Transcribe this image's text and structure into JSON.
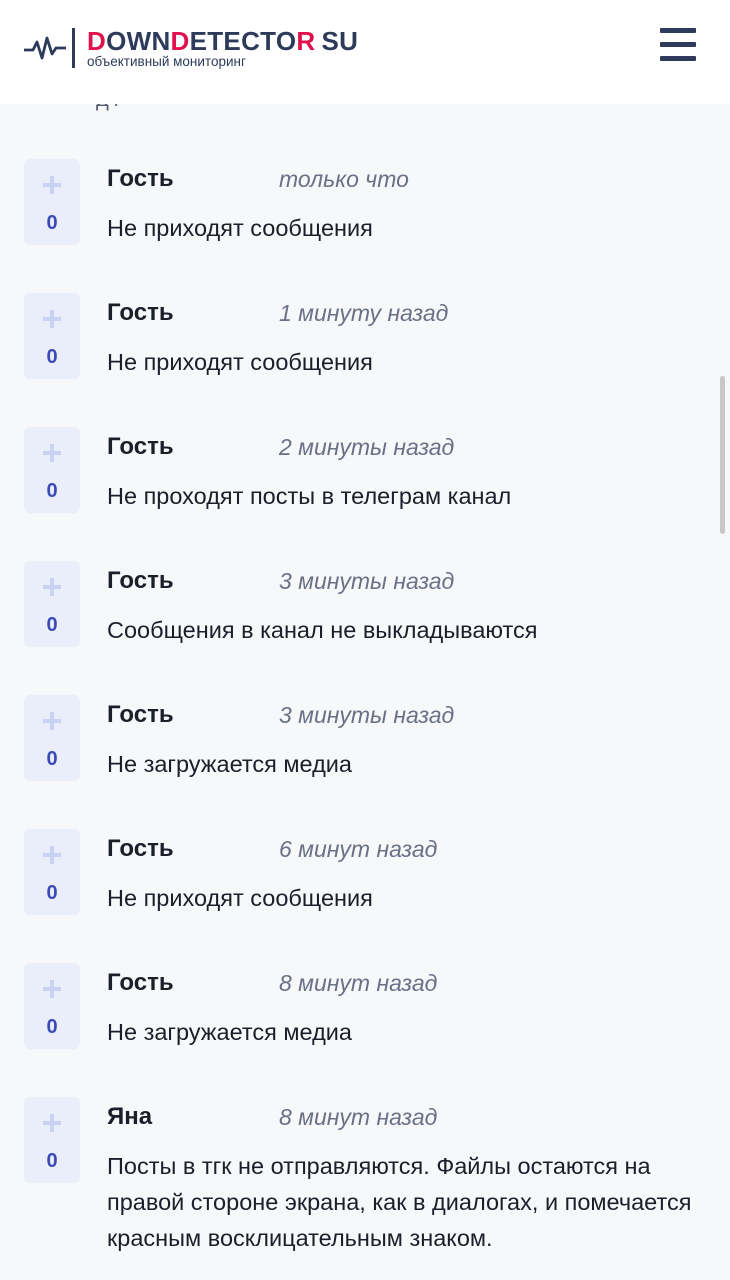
{
  "header": {
    "brand_parts": [
      "D",
      "OWN",
      "D",
      "ETECTO",
      "R"
    ],
    "brand_su": "SU",
    "subtitle": "объективный мониторинг"
  },
  "cutoff_text": "д       /",
  "comments": [
    {
      "author": "Гость",
      "time": "только что",
      "text": "Не приходят сообщения",
      "votes": "0"
    },
    {
      "author": "Гость",
      "time": "1 минуту назад",
      "text": "Не приходят сообщения",
      "votes": "0"
    },
    {
      "author": "Гость",
      "time": "2 минуты назад",
      "text": "Не проходят посты в телеграм канал",
      "votes": "0"
    },
    {
      "author": "Гость",
      "time": "3 минуты назад",
      "text": "Сообщения в канал не выкладываются",
      "votes": "0"
    },
    {
      "author": "Гость",
      "time": "3 минуты назад",
      "text": "Не загружается медиа",
      "votes": "0"
    },
    {
      "author": "Гость",
      "time": "6 минут назад",
      "text": "Не приходят сообщения",
      "votes": "0"
    },
    {
      "author": "Гость",
      "time": "8 минут назад",
      "text": "Не загружается медиа",
      "votes": "0"
    },
    {
      "author": "Яна",
      "time": "8 минут назад",
      "text": "Посты в тгк не отправляются. Файлы остаются на правой стороне экрана, как в диалогах, и помечается красным восклицательным знаком.",
      "votes": "0"
    }
  ],
  "colors": {
    "accent": "#e0114c",
    "brand": "#2d3a5a",
    "vote_bg": "#eaeefb",
    "vote_count": "#3a4bb5"
  }
}
